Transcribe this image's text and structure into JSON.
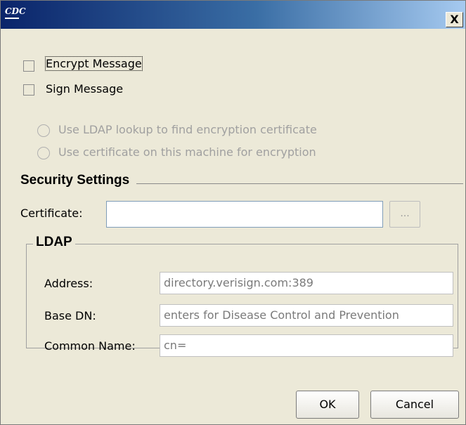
{
  "titlebar": {
    "logo_text": "CDC",
    "close_label": "X"
  },
  "options": {
    "encrypt_label": "Encrypt Message",
    "sign_label": "Sign Message",
    "radio_ldap_label": "Use LDAP lookup to find encryption certificate",
    "radio_local_label": "Use certificate on this machine for encryption"
  },
  "security": {
    "title": "Security Settings",
    "certificate_label": "Certificate:",
    "certificate_value": "",
    "browse_label": "..."
  },
  "ldap": {
    "title": "LDAP",
    "address_label": "Address:",
    "address_value": "directory.verisign.com:389",
    "basedn_label": "Base DN:",
    "basedn_value": "enters for Disease Control and Prevention",
    "common_name_label": "Common Name:",
    "common_name_value": "cn="
  },
  "buttons": {
    "ok_label": "OK",
    "cancel_label": "Cancel"
  }
}
